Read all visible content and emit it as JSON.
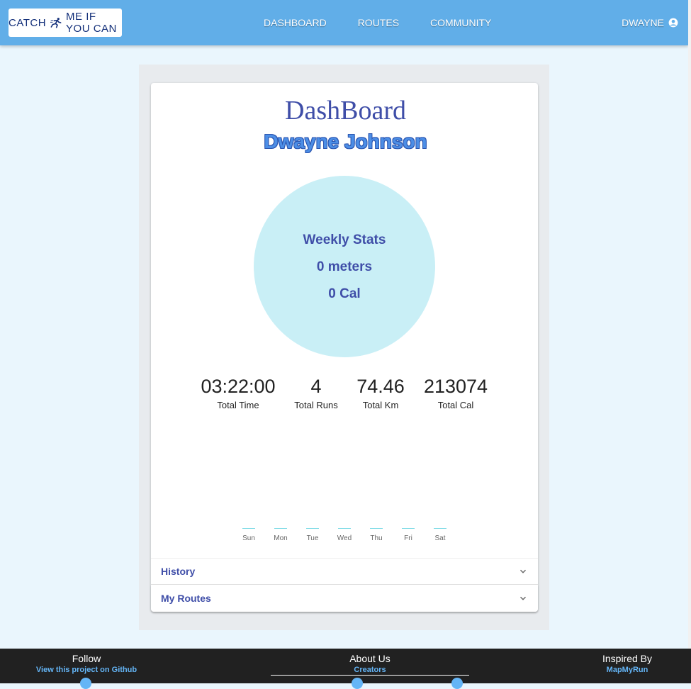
{
  "logo": {
    "left": "CATCH",
    "right": "ME IF YOU CAN",
    "icon": "runner-icon"
  },
  "nav": {
    "items": [
      "DASHBOARD",
      "ROUTES",
      "COMMUNITY"
    ]
  },
  "user": {
    "name": "DWAYNE",
    "icon": "account-circle-icon"
  },
  "dashboard": {
    "title": "DashBoard",
    "name": "Dwayne Johnson",
    "weekly": {
      "heading": "Weekly Stats",
      "distance": "0 meters",
      "calories": "0 Cal"
    },
    "stats": [
      {
        "value": "03:22:00",
        "label": "Total Time"
      },
      {
        "value": "4",
        "label": "Total Runs"
      },
      {
        "value": "74.46",
        "label": "Total Km"
      },
      {
        "value": "213074",
        "label": "Total Cal"
      }
    ]
  },
  "chart_data": {
    "type": "bar",
    "categories": [
      "Sun",
      "Mon",
      "Tue",
      "Wed",
      "Thu",
      "Fri",
      "Sat"
    ],
    "values": [
      0,
      0,
      0,
      0,
      0,
      0,
      0
    ],
    "title": "",
    "xlabel": "",
    "ylabel": "",
    "color": "#7fdbe6"
  },
  "accordions": [
    {
      "label": "History",
      "icon": "chevron-down-icon"
    },
    {
      "label": "My Routes",
      "icon": "chevron-down-icon"
    }
  ],
  "footer": {
    "follow": {
      "heading": "Follow",
      "link": "View this project on Github"
    },
    "about": {
      "heading": "About Us",
      "link": "Creators"
    },
    "inspired": {
      "heading": "Inspired By",
      "link": "MapMyRun"
    }
  }
}
